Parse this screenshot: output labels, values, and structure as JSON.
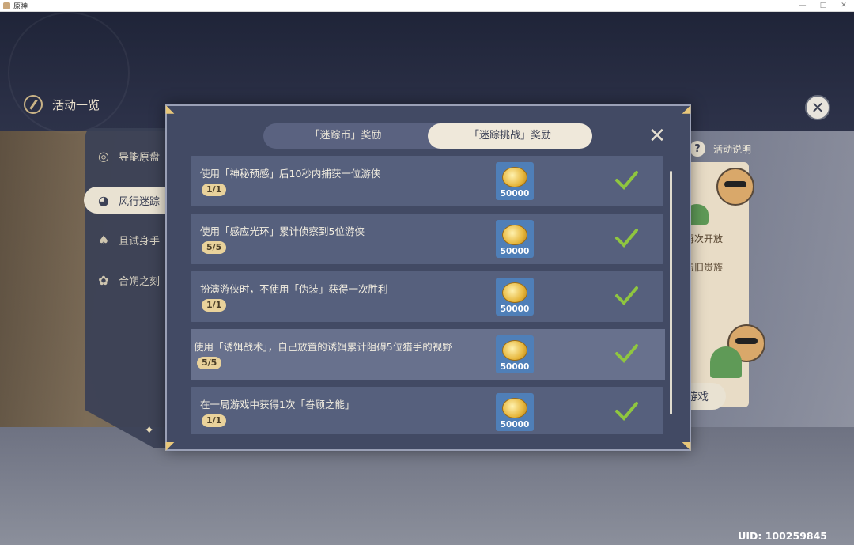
{
  "window": {
    "title": "原神",
    "controls": [
      "—",
      "□",
      "✕"
    ]
  },
  "header": {
    "title": "活动一览",
    "icon": "compass-icon"
  },
  "close_main": "✕",
  "sidebar": {
    "items": [
      {
        "label": "导能原盘",
        "icon": "disc-icon",
        "active": false
      },
      {
        "label": "风行迷踪",
        "icon": "cat-mask-icon",
        "active": true
      },
      {
        "label": "且试身手",
        "icon": "cards-icon",
        "active": false
      },
      {
        "label": "合朔之刻",
        "icon": "lotus-icon",
        "active": false
      }
    ]
  },
  "right_panel": {
    "activity_desc": "活动说明",
    "help_icon": "?",
    "text1": "再次开放",
    "text2": "与旧贵族",
    "play_label": "游戏"
  },
  "modal": {
    "tabs": [
      {
        "label": "「迷踪币」奖励",
        "active": false
      },
      {
        "label": "「迷踪挑战」奖励",
        "active": true
      }
    ],
    "close": "✕",
    "rows": [
      {
        "desc": "使用「神秘预感」后10秒内捕获一位游侠",
        "progress": "1/1",
        "reward_amount": "50000",
        "completed": true
      },
      {
        "desc": "使用「感应光环」累计侦察到5位游侠",
        "progress": "5/5",
        "reward_amount": "50000",
        "completed": true
      },
      {
        "desc": "扮演游侠时，不使用「伪装」获得一次胜利",
        "progress": "1/1",
        "reward_amount": "50000",
        "completed": true
      },
      {
        "desc": "使用「诱饵战术」，自己放置的诱饵累计阻碍5位猎手的视野",
        "progress": "5/5",
        "reward_amount": "50000",
        "completed": true
      },
      {
        "desc": "在一局游戏中获得1次「眷顾之能」",
        "progress": "1/1",
        "reward_amount": "50000",
        "completed": true
      }
    ]
  },
  "uid": "UID: 100259845",
  "colors": {
    "accent_gold": "#e9d29b",
    "check_green": "#8fc63f",
    "panel_bg": "#424a64",
    "reward_bg": "#4f7fb8"
  }
}
